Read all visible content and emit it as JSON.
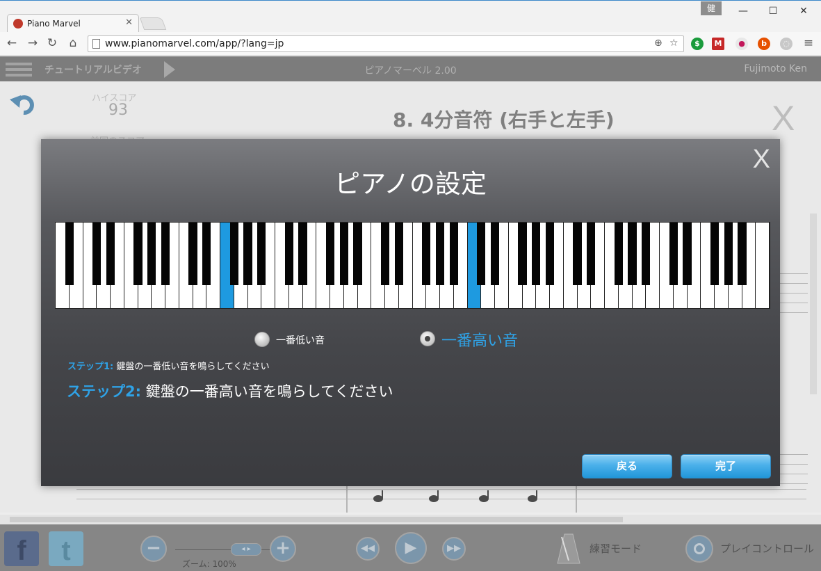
{
  "browser": {
    "tab_title": "Piano Marvel",
    "url": "www.pianomarvel.com/app/?lang=jp",
    "profile_badge": "健",
    "icons": [
      "back-arrow",
      "forward-arrow",
      "reload",
      "home",
      "zoom",
      "bookmark-star",
      "menu"
    ]
  },
  "app_header": {
    "tutorial_label": "チュートリアルビデオ",
    "app_title": "ピアノマーベル 2.00",
    "user_name": "Fujimoto Ken"
  },
  "background": {
    "high_score_label": "ハイスコア",
    "high_score_value": "93",
    "previous_score_label": "前回のスコア",
    "lesson_title": "8. 4分音符 (右手と左手)",
    "close_glyph": "X"
  },
  "modal": {
    "title": "ピアノの設定",
    "close_glyph": "X",
    "keyboard": {
      "white_key_count": 52,
      "highlighted_white_keys": [
        12,
        30
      ],
      "highlighted_key_color": "#1e9ae0"
    },
    "radio_lowest_label": "一番低い音",
    "radio_highest_label": "一番高い音",
    "selected_option": "highest",
    "step1_label": "ステップ1:",
    "step1_text": "鍵盤の一番低い音を鳴らしてください",
    "step2_label": "ステップ2:",
    "step2_text": "鍵盤の一番高い音を鳴らしてください",
    "back_button": "戻る",
    "done_button": "完了",
    "accent_color": "#2fa2e6"
  },
  "bottom_bar": {
    "zoom_label": "ズーム: 100%",
    "zoom_minus": "−",
    "zoom_plus": "+",
    "practice_mode_label": "練習モード",
    "play_control_label": "プレイコントロール"
  }
}
